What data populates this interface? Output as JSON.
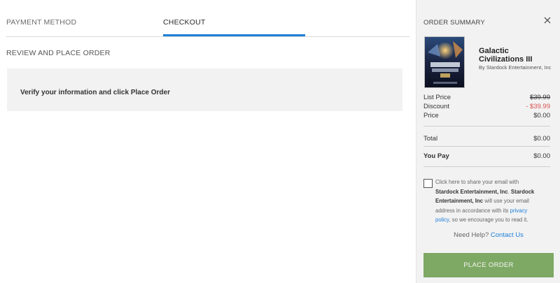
{
  "tabs": [
    {
      "label": "PAYMENT METHOD",
      "active": false
    },
    {
      "label": "CHECKOUT",
      "active": true
    }
  ],
  "main": {
    "section_title": "REVIEW AND PLACE ORDER",
    "info_text": "Verify your information and click Place Order"
  },
  "summary": {
    "title": "ORDER SUMMARY",
    "close_icon": "close-icon",
    "game": {
      "title": "Galactic Civilizations III",
      "by": "By Stardock Entertainment, Inc"
    },
    "rows": {
      "list_price_label": "List Price",
      "list_price_value": "$39.99",
      "discount_label": "Discount",
      "discount_value": "- $39.99",
      "price_label": "Price",
      "price_value": "$0.00",
      "total_label": "Total",
      "total_value": "$0.00",
      "you_pay_label": "You Pay",
      "you_pay_value": "$0.00"
    },
    "consent": {
      "prefix": "Click here to share your email with ",
      "company1": "Stardock Entertainment, Inc",
      "mid1": ". ",
      "company2": "Stardock Entertainment, Inc",
      "mid2": " will use your email address in accordance with its ",
      "link": "privacy policy",
      "suffix": ", so we encourage you to read it."
    },
    "help_text": "Need Help?",
    "help_link": "Contact Us",
    "place_order_label": "PLACE ORDER"
  },
  "colors": {
    "accent_blue": "#1e7fd8",
    "button_green": "#7ea964",
    "discount_red": "#d9534f",
    "sidebar_bg": "#f2f2f2"
  }
}
